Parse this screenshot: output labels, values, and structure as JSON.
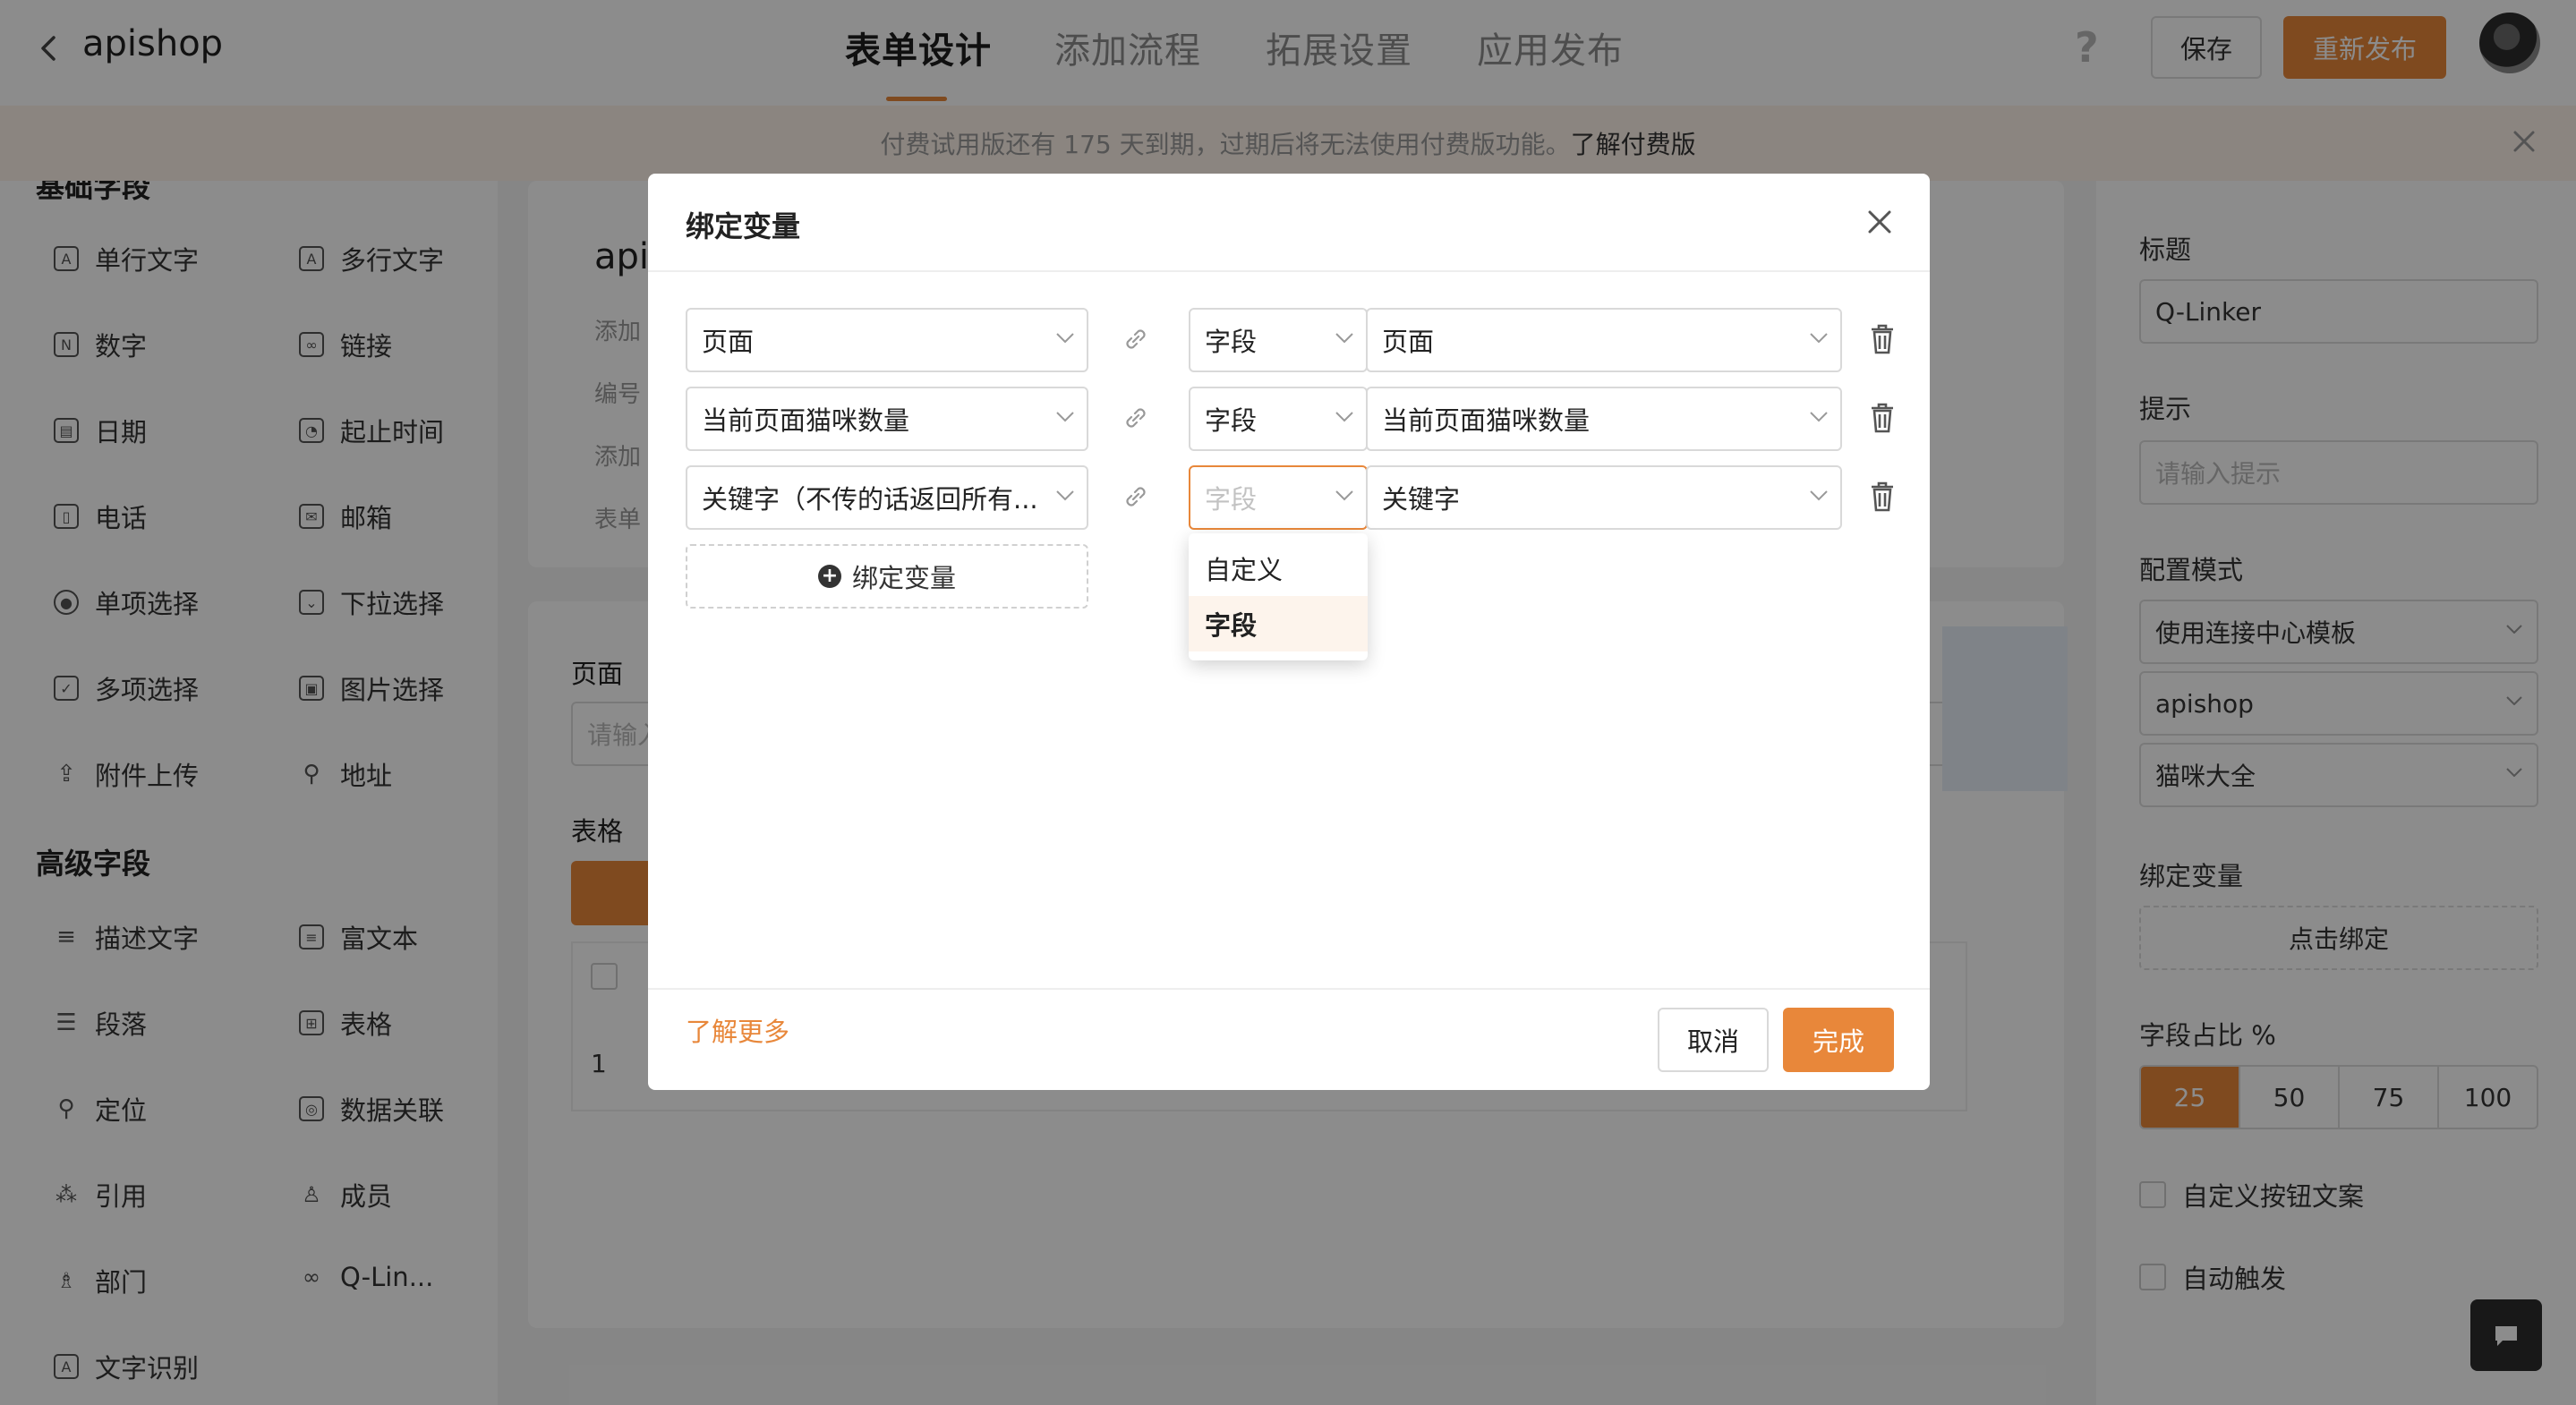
{
  "header": {
    "app_title": "apishop",
    "tabs": [
      {
        "label": "表单设计",
        "active": true
      },
      {
        "label": "添加流程",
        "active": false
      },
      {
        "label": "拓展设置",
        "active": false
      },
      {
        "label": "应用发布",
        "active": false
      }
    ],
    "help": "?",
    "save_label": "保存",
    "publish_label": "重新发布"
  },
  "banner": {
    "text": "付费试用版还有 175 天到期，过期后将无法使用付费版功能。",
    "link": "了解付费版"
  },
  "sidebar": {
    "basic_title": "基础字段",
    "basic_fields": [
      {
        "label": "单行文字",
        "icon": "A"
      },
      {
        "label": "多行文字",
        "icon": "A"
      },
      {
        "label": "数字",
        "icon": "N"
      },
      {
        "label": "链接",
        "icon": "link"
      },
      {
        "label": "日期",
        "icon": "cal"
      },
      {
        "label": "起止时间",
        "icon": "clock"
      },
      {
        "label": "电话",
        "icon": "phone"
      },
      {
        "label": "邮箱",
        "icon": "mail"
      },
      {
        "label": "单项选择",
        "icon": "radio"
      },
      {
        "label": "下拉选择",
        "icon": "select"
      },
      {
        "label": "多项选择",
        "icon": "check"
      },
      {
        "label": "图片选择",
        "icon": "image"
      },
      {
        "label": "附件上传",
        "icon": "upload"
      },
      {
        "label": "地址",
        "icon": "pin"
      }
    ],
    "adv_title": "高级字段",
    "adv_fields": [
      {
        "label": "描述文字",
        "icon": "text"
      },
      {
        "label": "富文本",
        "icon": "doc"
      },
      {
        "label": "段落",
        "icon": "para"
      },
      {
        "label": "表格",
        "icon": "table"
      },
      {
        "label": "定位",
        "icon": "loc"
      },
      {
        "label": "数据关联",
        "icon": "search"
      },
      {
        "label": "引用",
        "icon": "ref"
      },
      {
        "label": "成员",
        "icon": "user"
      },
      {
        "label": "部门",
        "icon": "dept"
      },
      {
        "label": "Q-Lin...",
        "icon": "link"
      },
      {
        "label": "文字识别",
        "icon": "ocr"
      }
    ]
  },
  "canvas": {
    "form_title": "apish",
    "rows": [
      "添加",
      "编号",
      "添加",
      "表单"
    ],
    "field_page_label": "页面",
    "field_page_placeholder": "请输入",
    "table_label": "表格",
    "table_row_num": "1"
  },
  "right_panel": {
    "title_label": "标题",
    "title_value": "Q-Linker",
    "hint_label": "提示",
    "hint_placeholder": "请输入提示",
    "config_label": "配置模式",
    "config_value": "使用连接中心模板",
    "app_value": "apishop",
    "api_value": "猫咪大全",
    "bind_label": "绑定变量",
    "bind_button": "点击绑定",
    "ratio_label": "字段占比 %",
    "ratio_options": [
      "25",
      "50",
      "75",
      "100"
    ],
    "ratio_selected": "25",
    "custom_btn_label": "自定义按钮文案",
    "auto_trigger_label": "自动触发"
  },
  "modal": {
    "title": "绑定变量",
    "rows": [
      {
        "left": "页面",
        "type": "字段",
        "right": "页面",
        "type_placeholder": false
      },
      {
        "left": "当前页面猫咪数量",
        "type": "字段",
        "right": "当前页面猫咪数量",
        "type_placeholder": false
      },
      {
        "left": "关键字（不传的话返回所有...",
        "type": "字段",
        "right": "关键字",
        "type_placeholder": true
      }
    ],
    "add_label": "绑定变量",
    "dropdown_options": [
      {
        "label": "自定义",
        "selected": false
      },
      {
        "label": "字段",
        "selected": true
      }
    ],
    "learn_more": "了解更多",
    "cancel_label": "取消",
    "done_label": "完成"
  },
  "colors": {
    "accent": "#e8873a",
    "overlay": "rgba(0,0,0,0.45)"
  }
}
